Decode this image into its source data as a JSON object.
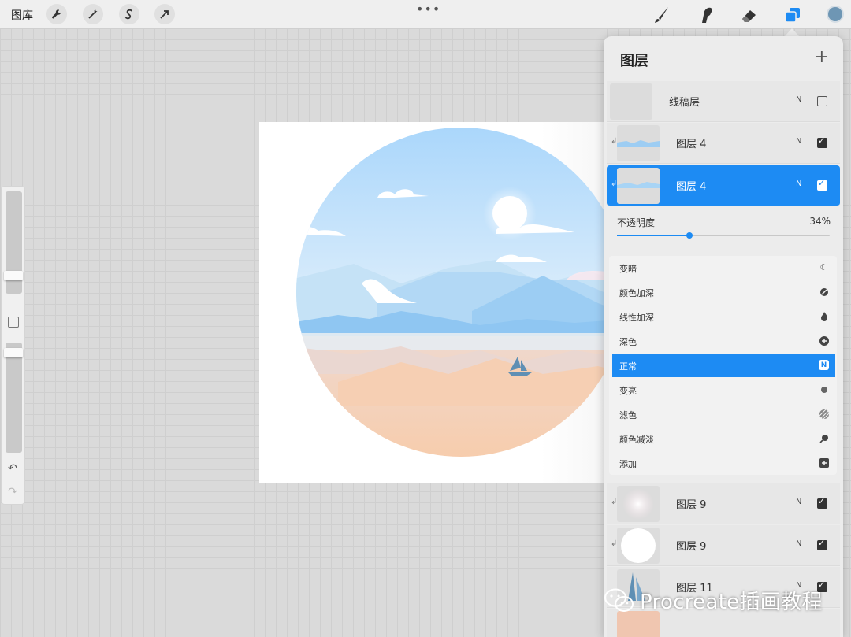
{
  "topbar": {
    "gallery_label": "图库",
    "more_label": "•••"
  },
  "canvas": {
    "accent_sky": "#9fd0f5",
    "accent_sand": "#f7c9a5"
  },
  "layers_panel": {
    "title": "图层",
    "add_label": "+",
    "layers_top": [
      {
        "name": "线稿层",
        "blend": "N",
        "visible": false,
        "clipped": false
      },
      {
        "name": "图层 4",
        "blend": "N",
        "visible": true,
        "clipped": true
      },
      {
        "name": "图层 4",
        "blend": "N",
        "visible": true,
        "clipped": true,
        "selected": true
      }
    ],
    "opacity_label": "不透明度",
    "opacity_value": "34%",
    "opacity_fraction": 0.34,
    "blend_modes": [
      {
        "label": "变暗",
        "icon": "moon-icon"
      },
      {
        "label": "颜色加深",
        "icon": "burn-icon"
      },
      {
        "label": "线性加深",
        "icon": "flame-icon"
      },
      {
        "label": "深色",
        "icon": "plus-circle-icon"
      },
      {
        "label": "正常",
        "icon": "n-icon",
        "badge": "N",
        "active": true
      },
      {
        "label": "变亮",
        "icon": "sun-icon"
      },
      {
        "label": "滤色",
        "icon": "hatch-icon"
      },
      {
        "label": "颜色减淡",
        "icon": "dodge-icon"
      },
      {
        "label": "添加",
        "icon": "plus-square-icon"
      }
    ],
    "layers_bottom": [
      {
        "name": "图层 9",
        "blend": "N",
        "visible": true,
        "clipped": true
      },
      {
        "name": "图层 9",
        "blend": "N",
        "visible": true,
        "clipped": true
      },
      {
        "name": "图层 11",
        "blend": "N",
        "visible": true,
        "clipped": false
      }
    ]
  },
  "watermark": {
    "text": "Procreate插画教程"
  },
  "colors": {
    "selection_blue": "#1d8bf3",
    "current_color": "#6e96b4"
  }
}
